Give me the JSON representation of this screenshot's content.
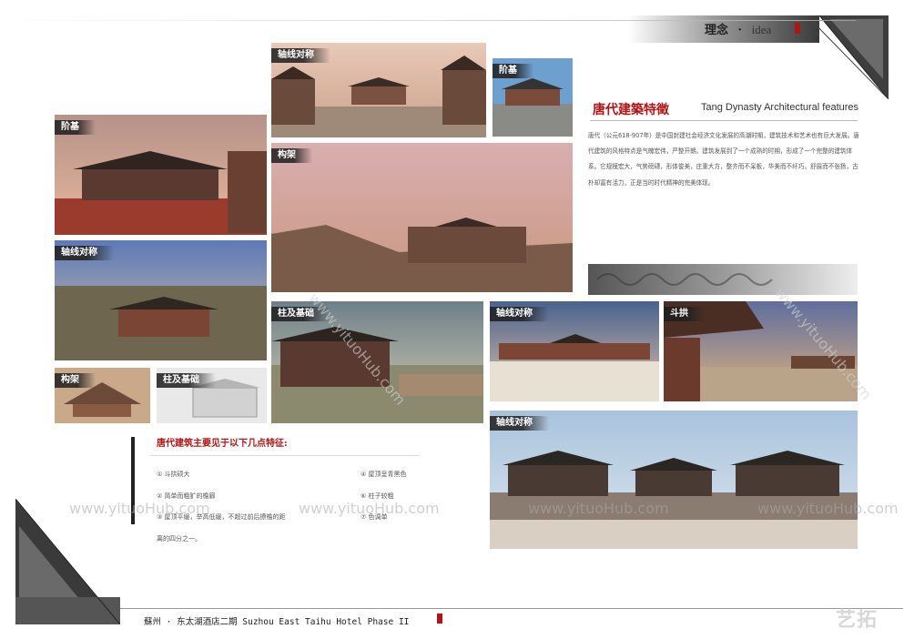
{
  "header": {
    "title_cn": "理念",
    "title_dot": "·",
    "title_en": "idea",
    "accent": "#b01414"
  },
  "tiles": [
    {
      "label": "轴线对称"
    },
    {
      "label": "阶基"
    },
    {
      "label": "阶基"
    },
    {
      "label": "构架"
    },
    {
      "label": "轴线对称"
    },
    {
      "label": "构架"
    },
    {
      "label": "柱及基础"
    },
    {
      "label": "柱及基础"
    },
    {
      "label": "轴线对称"
    },
    {
      "label": "斗拱"
    },
    {
      "label": "轴线对称"
    }
  ],
  "section": {
    "title_cn": "唐代建築特徵",
    "title_en": "Tang Dynasty Architectural features",
    "paragraph": "唐代（公元618-907年）是中国封建社会经济文化发展的高潮时期，建筑技术和艺术也有巨大发展。唐代建筑的风格特点是气魄宏伟，严整开朗。建筑发展到了一个成熟的时期，形成了一个完整的建筑体系。它规模宏大，气势磅礴，形体俊美，庄重大方，整齐而不呆板，华美而不纤巧，舒展而不张扬，古朴却富有活力，正是当时时代精神的完美体现。"
  },
  "features": {
    "title": "唐代建筑主要见于以下几点特征:",
    "items": [
      "① 斗拱硕大",
      "④ 屋顶呈青黑色",
      "② 简单而粗犷的檐廊",
      "⑥ 柱子较粗",
      "③ 屋顶平缓，举高低缓，不超过前后撩檐的距",
      "⑦ 色调单",
      "离的四分之一。"
    ]
  },
  "watermark": {
    "text": "www.yituoHub.com",
    "logo": "艺拓"
  },
  "footer": {
    "text": "蘇州 · 东太湖酒店二期  Suzhou East Taihu Hotel Phase II"
  }
}
